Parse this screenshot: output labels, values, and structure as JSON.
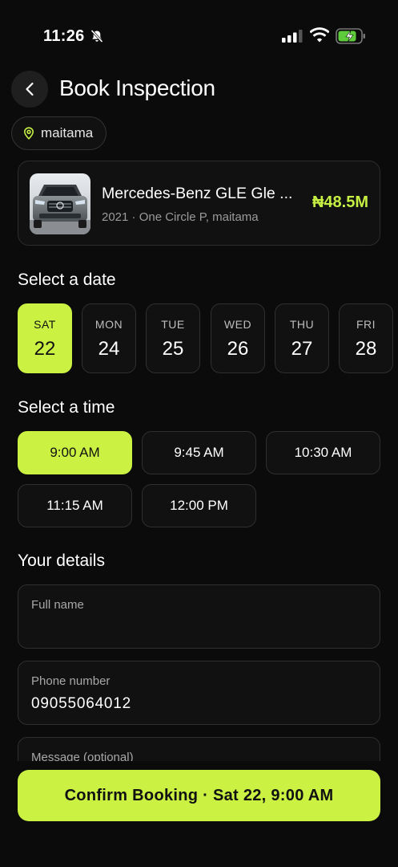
{
  "status_bar": {
    "time": "11:26"
  },
  "header": {
    "title": "Book Inspection"
  },
  "location": {
    "label": "maitama"
  },
  "listing": {
    "name": "Mercedes-Benz GLE Gle ...",
    "subtitle": "2021 · One Circle P, maitama",
    "price": "₦48.5M"
  },
  "date_section": {
    "title": "Select a date",
    "dates": [
      {
        "day": "SAT",
        "num": "22",
        "selected": true
      },
      {
        "day": "MON",
        "num": "24"
      },
      {
        "day": "TUE",
        "num": "25"
      },
      {
        "day": "WED",
        "num": "26"
      },
      {
        "day": "THU",
        "num": "27"
      },
      {
        "day": "FRI",
        "num": "28"
      }
    ]
  },
  "time_section": {
    "title": "Select a time",
    "slots": [
      "9:00 AM",
      "9:45 AM",
      "10:30 AM",
      "11:15 AM",
      "12:00 PM"
    ],
    "selected": "9:00 AM"
  },
  "details": {
    "title": "Your details",
    "full_name_label": "Full name",
    "full_name_value": "",
    "phone_label": "Phone number",
    "phone_value": "09055064012",
    "message_label": "Message (optional)"
  },
  "confirm": {
    "label": "Confirm Booking · Sat 22, 9:00 AM"
  },
  "colors": {
    "accent": "#cbf143",
    "background": "#0b0b0b",
    "card": "#111111"
  }
}
